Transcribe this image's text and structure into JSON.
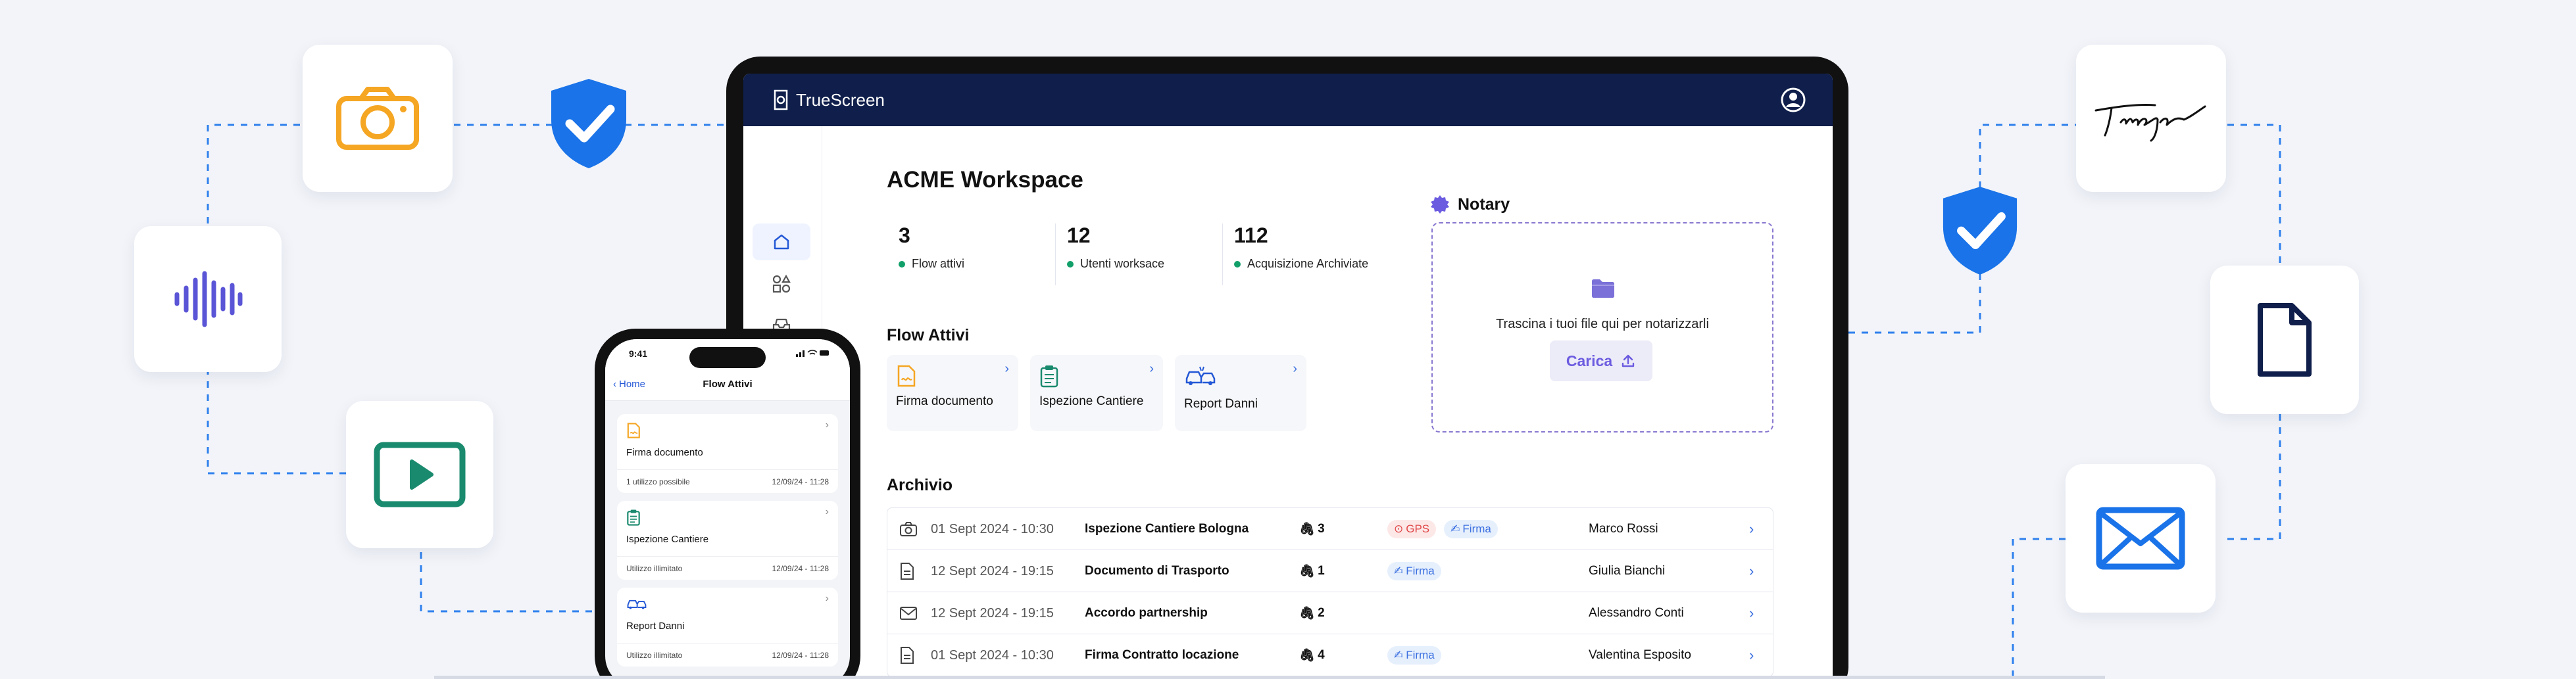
{
  "app": {
    "name": "TrueScreen"
  },
  "workspace": {
    "title": "ACME Workspace",
    "stats": [
      {
        "value": "3",
        "label": "Flow attivi"
      },
      {
        "value": "12",
        "label": "Utenti worksace"
      },
      {
        "value": "112",
        "label": "Acquisizione Archiviate"
      }
    ]
  },
  "flows": {
    "title": "Flow Attivi",
    "items": [
      {
        "label": "Firma documento",
        "icon": "document-sign-icon"
      },
      {
        "label": "Ispezione Cantiere",
        "icon": "clipboard-icon"
      },
      {
        "label": "Report Danni",
        "icon": "car-crash-icon"
      }
    ]
  },
  "notary": {
    "title": "Notary",
    "drop_text": "Trascina i tuoi file qui per notarizzarli",
    "upload_label": "Carica"
  },
  "archive": {
    "title": "Archivio",
    "rows": [
      {
        "icon": "camera-icon",
        "date": "01 Sept 2024 - 10:30",
        "name": "Ispezione Cantiere Bologna",
        "attachments": "3",
        "tags": [
          "GPS",
          "Firma"
        ],
        "person": "Marco Rossi"
      },
      {
        "icon": "document-icon",
        "date": "12 Sept 2024 - 19:15",
        "name": "Documento di Trasporto",
        "attachments": "1",
        "tags": [
          "Firma"
        ],
        "person": "Giulia Bianchi"
      },
      {
        "icon": "mail-icon",
        "date": "12 Sept 2024 - 19:15",
        "name": "Accordo partnership",
        "attachments": "2",
        "tags": [],
        "person": "Alessandro Conti"
      },
      {
        "icon": "document-icon",
        "date": "01 Sept 2024 - 10:30",
        "name": "Firma Contratto locazione",
        "attachments": "4",
        "tags": [
          "Firma"
        ],
        "person": "Valentina Esposito"
      }
    ]
  },
  "phone": {
    "time": "9:41",
    "back_label": "Home",
    "title": "Flow Attivi",
    "cards": [
      {
        "label": "Firma documento",
        "usage": "1 utilizzo possibile",
        "date": "12/09/24 - 11:28"
      },
      {
        "label": "Ispezione Cantiere",
        "usage": "Utilizzo illimitato",
        "date": "12/09/24 - 11:28"
      },
      {
        "label": "Report Danni",
        "usage": "Utilizzo illimitato",
        "date": "12/09/24 - 11:28"
      }
    ]
  },
  "colors": {
    "navy": "#0f1e4a",
    "accent_blue": "#1a73e8",
    "purple": "#6c5ce0",
    "green_dot": "#12a06a",
    "orange": "#f5a623",
    "teal": "#1a8a6e",
    "wave_purple": "#5a55d6"
  },
  "floating_icons": [
    "camera-icon",
    "audio-wave-icon",
    "video-play-icon",
    "shield-check-icon",
    "signature-icon",
    "document-icon",
    "mail-icon"
  ]
}
